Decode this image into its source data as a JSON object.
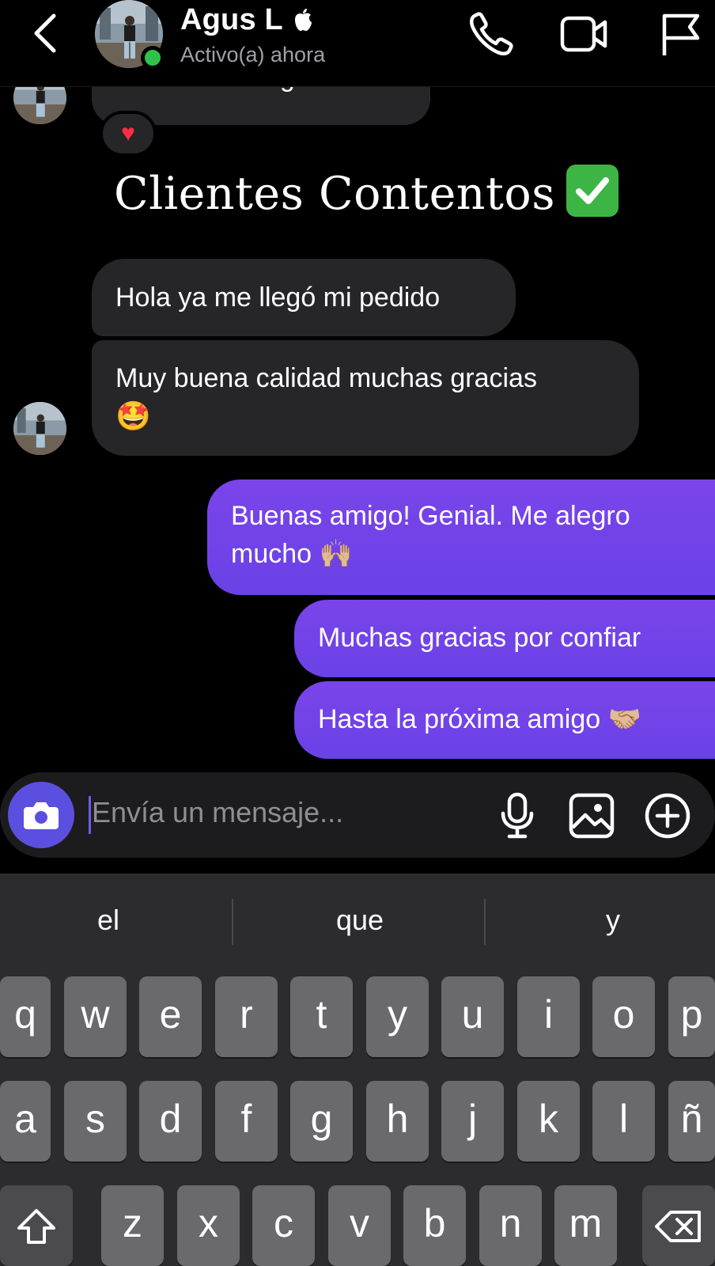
{
  "header": {
    "contact_name": "Agus L",
    "status": "Activo(a) ahora",
    "icons": [
      "back-chevron-icon",
      "apple-icon",
      "phone-icon",
      "video-camera-icon",
      "flag-icon"
    ]
  },
  "messages": {
    "partial_top": "Dale muchas gracias",
    "reaction": "♥",
    "caption": "Clientes Contentos",
    "received": [
      {
        "text": "Hola ya me llegó mi pedido"
      },
      {
        "text_line1": "Muy buena calidad muchas gracias",
        "emoji": "🤩"
      }
    ],
    "sent": [
      {
        "line1": "Buenas amigo! Genial. Me alegro",
        "line2": "mucho",
        "emoji": "🙌🏼"
      },
      {
        "text": "Muchas gracias por confiar"
      },
      {
        "text": "Hasta la próxima amigo",
        "emoji": "🤝🏼"
      }
    ]
  },
  "composer": {
    "placeholder": "Envía un mensaje...",
    "icons": [
      "camera-icon",
      "microphone-icon",
      "image-icon",
      "plus-icon"
    ]
  },
  "keyboard": {
    "suggestions": [
      "el",
      "que",
      "y"
    ],
    "row1": [
      "q",
      "w",
      "e",
      "r",
      "t",
      "y",
      "u",
      "i",
      "o",
      "p"
    ],
    "row2": [
      "a",
      "s",
      "d",
      "f",
      "g",
      "h",
      "j",
      "k",
      "l",
      "ñ"
    ],
    "row3": [
      "z",
      "x",
      "c",
      "v",
      "b",
      "n",
      "m"
    ]
  },
  "colors": {
    "background": "#000000",
    "received_bubble": "#262628",
    "sent_bubble": "#7244e8",
    "online": "#2fc24a",
    "camera_button": "#5b4fe0",
    "keyboard_bg": "#2c2c2e"
  }
}
